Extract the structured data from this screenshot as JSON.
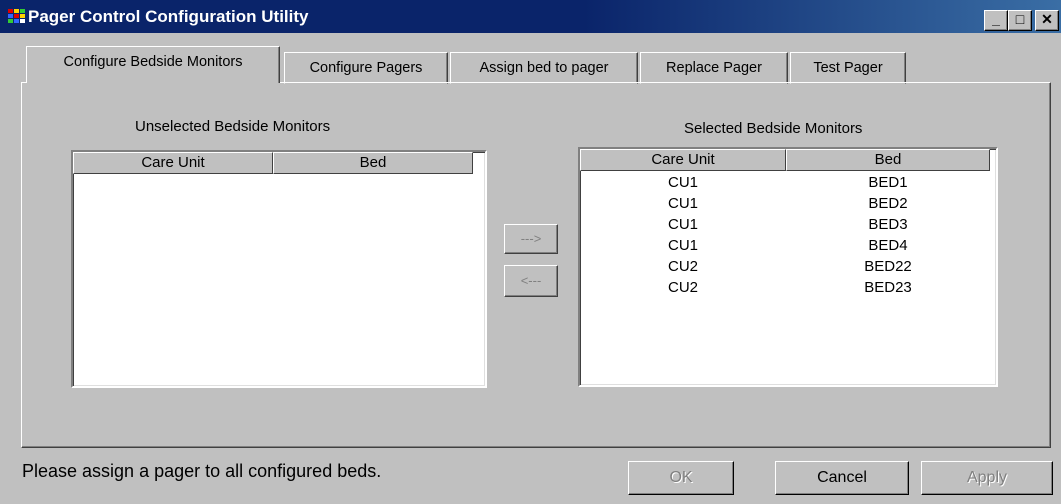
{
  "window": {
    "title": "Pager Control Configuration Utility",
    "minimize_glyph": "_",
    "maximize_glyph": "□",
    "close_glyph": "✕"
  },
  "tabs": [
    {
      "label": "Configure Bedside Monitors",
      "active": true
    },
    {
      "label": "Configure Pagers",
      "active": false
    },
    {
      "label": "Assign bed to pager",
      "active": false
    },
    {
      "label": "Replace Pager",
      "active": false
    },
    {
      "label": "Test Pager",
      "active": false
    }
  ],
  "unselected": {
    "label": "Unselected Bedside Monitors",
    "columns": [
      "Care Unit",
      "Bed"
    ],
    "rows": []
  },
  "selected": {
    "label": "Selected Bedside Monitors",
    "columns": [
      "Care Unit",
      "Bed"
    ],
    "rows": [
      {
        "care_unit": "CU1",
        "bed": "BED1"
      },
      {
        "care_unit": "CU1",
        "bed": "BED2"
      },
      {
        "care_unit": "CU1",
        "bed": "BED3"
      },
      {
        "care_unit": "CU1",
        "bed": "BED4"
      },
      {
        "care_unit": "CU2",
        "bed": "BED22"
      },
      {
        "care_unit": "CU2",
        "bed": "BED23"
      }
    ]
  },
  "transfer": {
    "add_label": "--->",
    "remove_label": "<---"
  },
  "status_message": "Please assign a pager to all configured beds.",
  "buttons": {
    "ok": "OK",
    "cancel": "Cancel",
    "apply": "Apply"
  }
}
